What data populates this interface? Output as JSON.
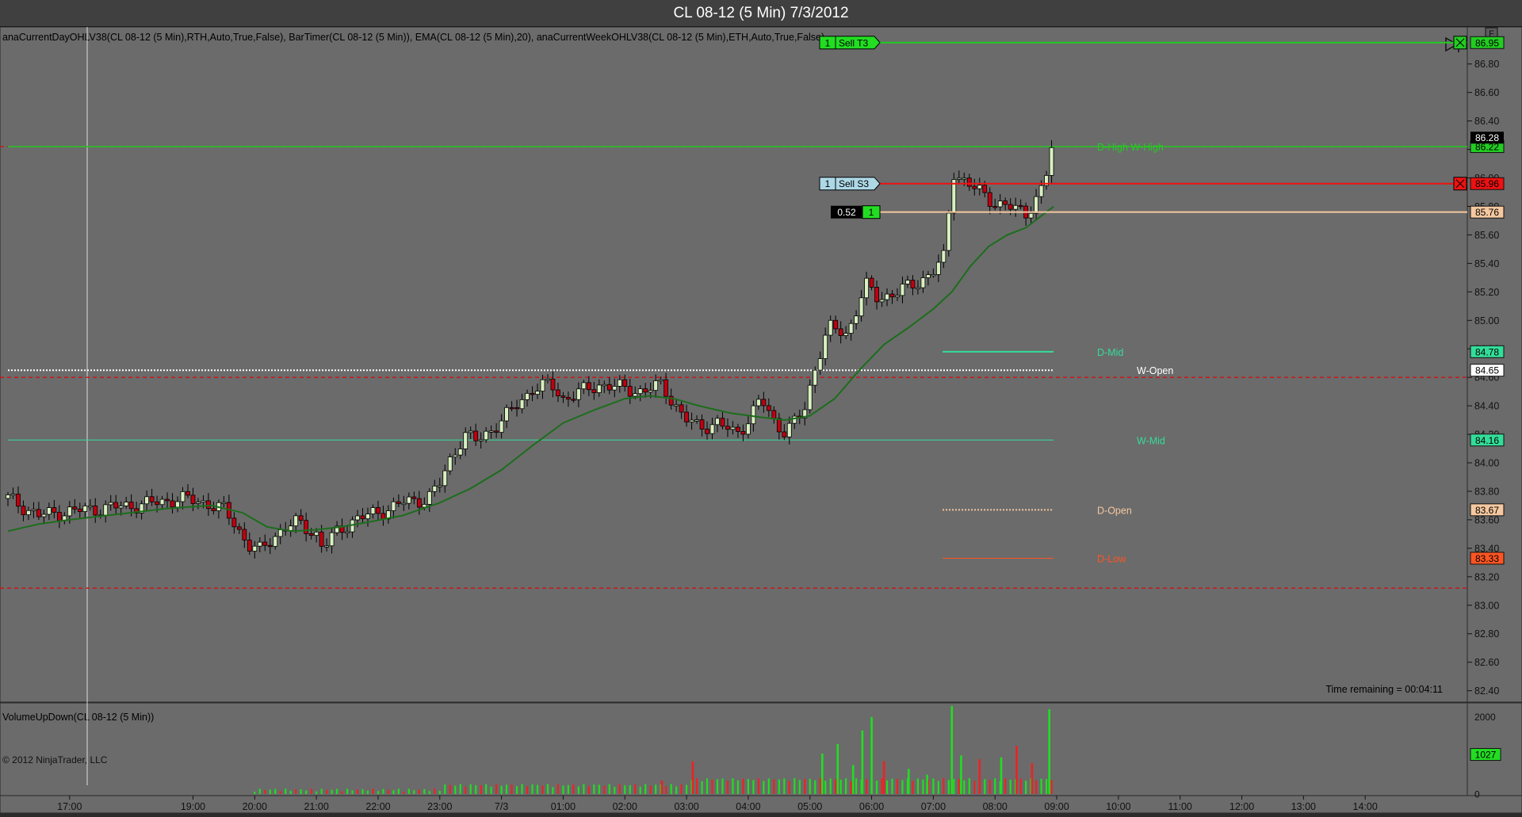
{
  "window": {
    "title": "CL 08-12 (5 Min)  7/3/2012"
  },
  "indicators_text": "anaCurrentDayOHLV38(CL  08-12  (5  Min),RTH,Auto,True,False),  BarTimer(CL  08-12  (5  Min)),  EMA(CL  08-12  (5  Min),20),  anaCurrentWeekOHLV38(CL  08-12  (5  Min),ETH,Auto,True,False)",
  "volume_panel_label": "VolumeUpDown(CL 08-12 (5 Min))",
  "copyright": "© 2012 NinjaTrader, LLC",
  "time_remaining": "Time remaining = 00:04:11",
  "f_button": "F",
  "colors": {
    "background": "#6b6b6b",
    "up_candle": "#d8f0c0",
    "down_candle": "#c00010",
    "ema": "#1c6d1c",
    "volume_up": "#22dd22",
    "volume_down": "#ee2222"
  },
  "orders": [
    {
      "qty": "1",
      "label": "Sell T3",
      "price": 86.95,
      "price_label": "86.95",
      "color": "#22cc22",
      "badge_bg": "#22dd22"
    },
    {
      "qty": "1",
      "label": "Sell S3",
      "price": 85.96,
      "price_label": "85.96",
      "color": "#ee1111",
      "badge_bg": "#add8e6"
    },
    {
      "pnl": "0.52",
      "qty": "1",
      "price": 85.76,
      "price_label": "85.76",
      "color": "#f5c8a0"
    }
  ],
  "levels": [
    {
      "name": "D-High  W-High",
      "price": 86.22,
      "price_label": "86.22",
      "color": "#22cc22"
    },
    {
      "name": "D-Mid",
      "price": 84.78,
      "price_label": "84.78",
      "color": "#33dd99"
    },
    {
      "name": "W-Open",
      "price": 84.65,
      "price_label": "84.65",
      "color": "#ffffff"
    },
    {
      "name": "W-Mid",
      "price": 84.16,
      "price_label": "84.16",
      "color": "#33dd99"
    },
    {
      "name": "D-Open",
      "price": 83.67,
      "price_label": "83.67",
      "color": "#f5c8a0"
    },
    {
      "name": "D-Low",
      "price": 83.33,
      "price_label": "83.33",
      "color": "#ff5522"
    }
  ],
  "last_price": {
    "price": 86.28,
    "label": "86.28"
  },
  "red_dashed_levels": [
    86.22,
    84.6,
    83.12
  ],
  "volume_last": "1027",
  "chart_data": {
    "type": "candlestick",
    "title": "CL 08-12 (5 Min)  7/3/2012",
    "y_ticks": [
      "86.80",
      "86.60",
      "86.40",
      "86.20",
      "86.00",
      "85.80",
      "85.60",
      "85.40",
      "85.20",
      "85.00",
      "84.80",
      "84.60",
      "84.40",
      "84.20",
      "84.00",
      "83.80",
      "83.60",
      "83.40",
      "83.20",
      "83.00",
      "82.80",
      "82.60",
      "82.40"
    ],
    "ylim": [
      82.32,
      87.06
    ],
    "x_ticks": [
      "17:00",
      "19:00",
      "20:00",
      "21:00",
      "22:00",
      "23:00",
      "7/3",
      "01:00",
      "02:00",
      "03:00",
      "04:00",
      "05:00",
      "06:00",
      "07:00",
      "08:00",
      "09:00",
      "10:00",
      "11:00",
      "12:00",
      "13:00",
      "14:00"
    ],
    "x_tick_hours": [
      17,
      19,
      20,
      21,
      22,
      23,
      24,
      25,
      26,
      27,
      28,
      29,
      30,
      31,
      32,
      33,
      34,
      35,
      36,
      37,
      38
    ],
    "x_range_hours": [
      16.0,
      39.0
    ],
    "close_path": [
      [
        16.0,
        83.75
      ],
      [
        16.5,
        83.63
      ],
      [
        17.0,
        83.66
      ],
      [
        17.5,
        83.68
      ],
      [
        18.0,
        83.7
      ],
      [
        18.4,
        83.72
      ],
      [
        18.8,
        83.75
      ],
      [
        19.2,
        83.72
      ],
      [
        19.5,
        83.67
      ],
      [
        19.7,
        83.56
      ],
      [
        19.9,
        83.42
      ],
      [
        20.1,
        83.38
      ],
      [
        20.3,
        83.48
      ],
      [
        20.5,
        83.55
      ],
      [
        20.7,
        83.58
      ],
      [
        21.0,
        83.5
      ],
      [
        21.1,
        83.4
      ],
      [
        21.3,
        83.5
      ],
      [
        21.6,
        83.6
      ],
      [
        22.0,
        83.65
      ],
      [
        22.4,
        83.72
      ],
      [
        22.8,
        83.75
      ],
      [
        23.0,
        83.85
      ],
      [
        23.2,
        84.05
      ],
      [
        23.4,
        84.2
      ],
      [
        23.6,
        84.15
      ],
      [
        23.8,
        84.22
      ],
      [
        24.0,
        84.3
      ],
      [
        24.2,
        84.38
      ],
      [
        24.5,
        84.52
      ],
      [
        24.8,
        84.55
      ],
      [
        25.0,
        84.45
      ],
      [
        25.3,
        84.5
      ],
      [
        25.6,
        84.55
      ],
      [
        26.0,
        84.52
      ],
      [
        26.3,
        84.5
      ],
      [
        26.6,
        84.55
      ],
      [
        26.9,
        84.35
      ],
      [
        27.0,
        84.3
      ],
      [
        27.2,
        84.25
      ],
      [
        27.5,
        84.28
      ],
      [
        27.8,
        84.2
      ],
      [
        28.0,
        84.3
      ],
      [
        28.2,
        84.45
      ],
      [
        28.4,
        84.3
      ],
      [
        28.6,
        84.22
      ],
      [
        28.9,
        84.35
      ],
      [
        29.1,
        84.7
      ],
      [
        29.3,
        84.95
      ],
      [
        29.6,
        84.9
      ],
      [
        29.9,
        85.25
      ],
      [
        30.1,
        85.15
      ],
      [
        30.4,
        85.2
      ],
      [
        30.7,
        85.25
      ],
      [
        31.0,
        85.35
      ],
      [
        31.2,
        85.45
      ],
      [
        31.3,
        86.05
      ],
      [
        31.6,
        85.95
      ],
      [
        31.9,
        85.85
      ],
      [
        32.2,
        85.8
      ],
      [
        32.5,
        85.75
      ],
      [
        32.8,
        85.95
      ],
      [
        32.95,
        86.28
      ]
    ],
    "ema_path": [
      [
        16.0,
        83.52
      ],
      [
        16.5,
        83.57
      ],
      [
        17.0,
        83.6
      ],
      [
        17.8,
        83.64
      ],
      [
        18.6,
        83.68
      ],
      [
        19.3,
        83.7
      ],
      [
        19.8,
        83.65
      ],
      [
        20.2,
        83.55
      ],
      [
        20.6,
        83.52
      ],
      [
        21.0,
        83.53
      ],
      [
        21.4,
        83.55
      ],
      [
        21.8,
        83.58
      ],
      [
        22.4,
        83.63
      ],
      [
        23.0,
        83.72
      ],
      [
        23.5,
        83.82
      ],
      [
        24.0,
        83.95
      ],
      [
        24.5,
        84.12
      ],
      [
        25.0,
        84.28
      ],
      [
        25.5,
        84.37
      ],
      [
        26.0,
        84.45
      ],
      [
        26.4,
        84.47
      ],
      [
        26.8,
        84.45
      ],
      [
        27.2,
        84.4
      ],
      [
        27.7,
        84.35
      ],
      [
        28.2,
        84.32
      ],
      [
        28.6,
        84.3
      ],
      [
        29.0,
        84.33
      ],
      [
        29.4,
        84.45
      ],
      [
        29.8,
        84.65
      ],
      [
        30.2,
        84.83
      ],
      [
        30.6,
        84.95
      ],
      [
        31.0,
        85.08
      ],
      [
        31.3,
        85.2
      ],
      [
        31.6,
        85.38
      ],
      [
        31.9,
        85.52
      ],
      [
        32.2,
        85.6
      ],
      [
        32.5,
        85.65
      ],
      [
        32.95,
        85.8
      ]
    ],
    "volume_ylim": [
      0,
      2200
    ],
    "volume_ticks": [
      "2000",
      "1000",
      "0"
    ],
    "volume_spikes": [
      {
        "x": 26.6,
        "v": 350,
        "up": false
      },
      {
        "x": 27.1,
        "v": 850,
        "up": false
      },
      {
        "x": 29.2,
        "v": 1050,
        "up": true
      },
      {
        "x": 29.45,
        "v": 1300,
        "up": true
      },
      {
        "x": 29.7,
        "v": 750,
        "up": true
      },
      {
        "x": 29.85,
        "v": 1650,
        "up": true
      },
      {
        "x": 30.0,
        "v": 2000,
        "up": true
      },
      {
        "x": 30.2,
        "v": 850,
        "up": false
      },
      {
        "x": 30.6,
        "v": 650,
        "up": true
      },
      {
        "x": 30.9,
        "v": 500,
        "up": true
      },
      {
        "x": 31.3,
        "v": 2350,
        "up": true
      },
      {
        "x": 31.45,
        "v": 1000,
        "up": true
      },
      {
        "x": 31.75,
        "v": 900,
        "up": false
      },
      {
        "x": 32.1,
        "v": 950,
        "up": true
      },
      {
        "x": 32.35,
        "v": 1250,
        "up": false
      },
      {
        "x": 32.6,
        "v": 800,
        "up": false
      },
      {
        "x": 32.88,
        "v": 2200,
        "up": true
      }
    ]
  }
}
